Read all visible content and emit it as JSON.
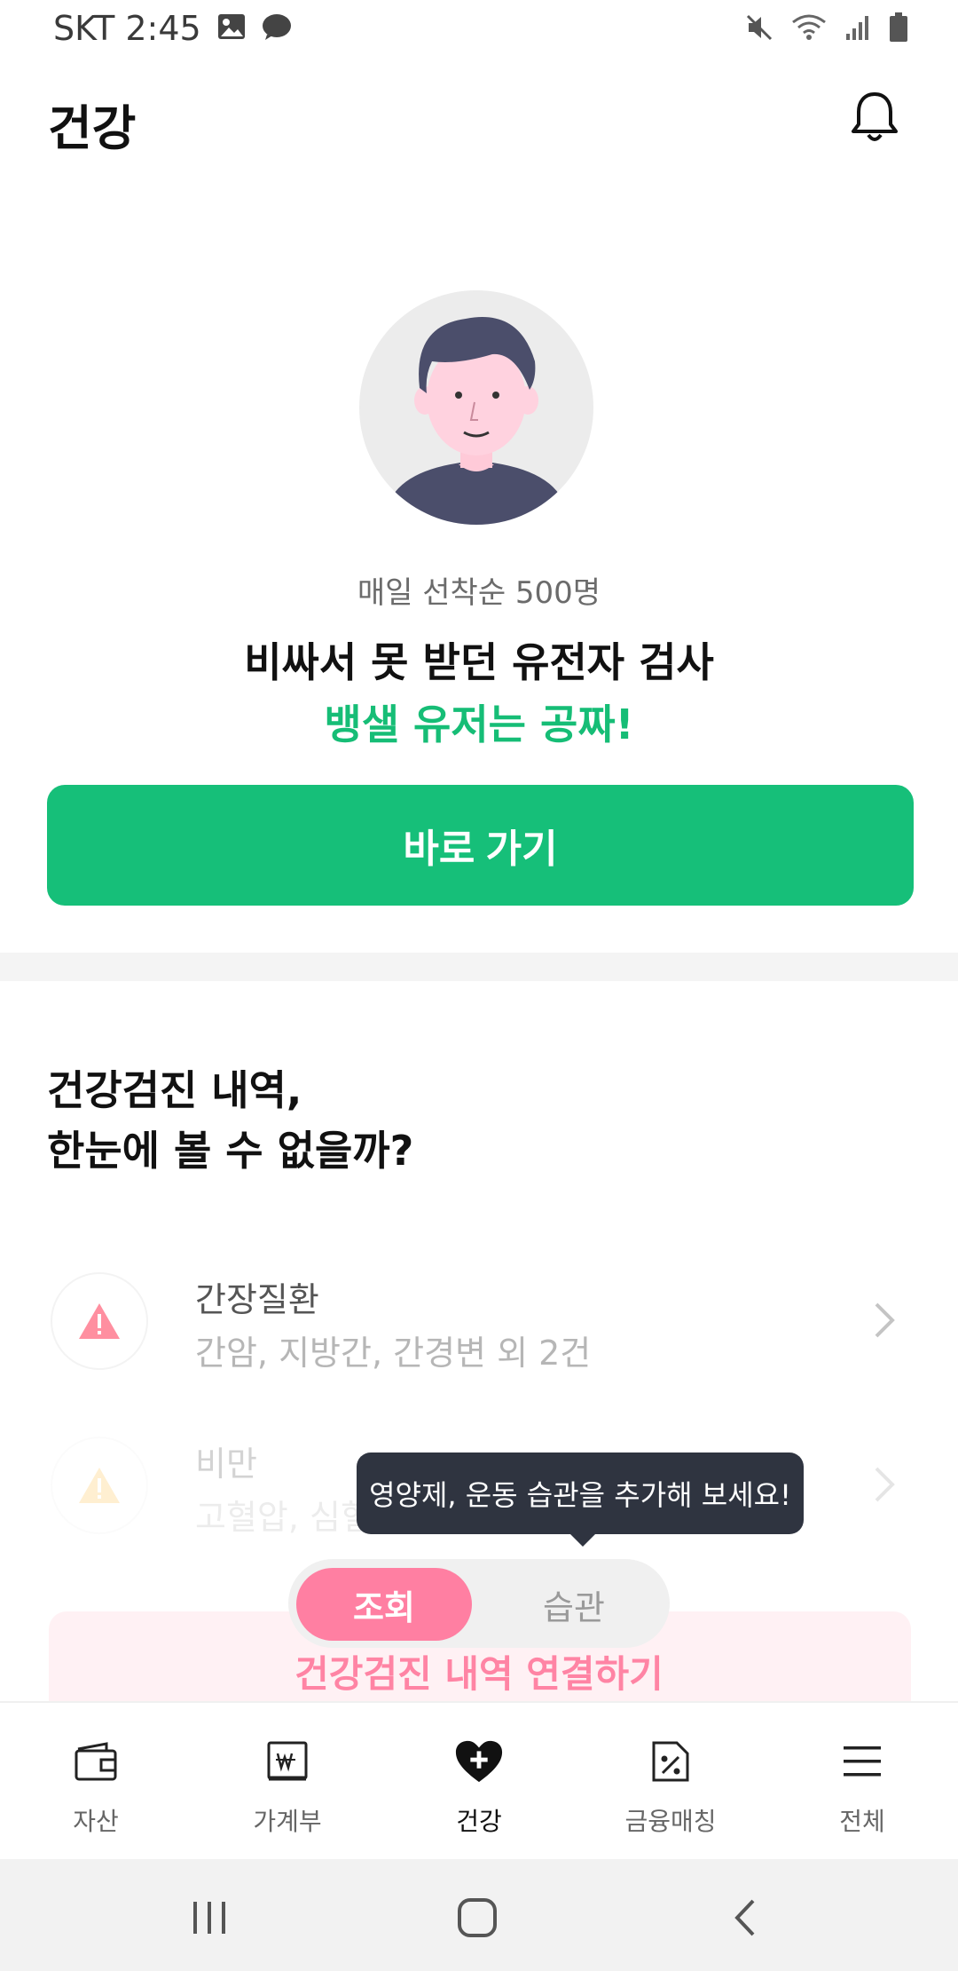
{
  "status_bar": {
    "carrier_time": "SKT 2:45",
    "icons": [
      "image-icon",
      "messenger-icon",
      "mute-icon",
      "wifi-icon",
      "signal-icon",
      "battery-icon"
    ]
  },
  "header": {
    "title": "건강",
    "bell_icon": "bell-icon"
  },
  "promo": {
    "subtitle": "매일 선착순 500명",
    "title": "비싸서 못 받던 유전자 검사",
    "highlight": "뱅샐 유저는 공짜!",
    "button_label": "바로 가기",
    "accent_color": "#16bf79"
  },
  "checkup_section": {
    "title_line1": "건강검진 내역,",
    "title_line2": "한눈에 볼 수 없을까?",
    "items": [
      {
        "name": "간장질환",
        "desc": "간암, 지방간, 간경변 외 2건",
        "icon": "warning-icon",
        "icon_color": "#ff8fa0"
      },
      {
        "name": "비만",
        "desc": "고혈압, 심혈",
        "icon": "warning-icon",
        "icon_color": "#ffc04a"
      }
    ],
    "connect_label": "건강검진 내역 연결하기"
  },
  "tooltip": {
    "text": "영양제, 운동 습관을 추가해 보세요!"
  },
  "segment": {
    "active_label": "조회",
    "inactive_label": "습관",
    "active_color": "#ff7fa2"
  },
  "bottom_nav": {
    "items": [
      {
        "label": "자산",
        "icon": "wallet-icon"
      },
      {
        "label": "가계부",
        "icon": "ledger-book-icon"
      },
      {
        "label": "건강",
        "icon": "heart-plus-icon",
        "active": true
      },
      {
        "label": "금융매칭",
        "icon": "coupon-percent-icon"
      },
      {
        "label": "전체",
        "icon": "menu-icon"
      }
    ]
  },
  "system_nav": {
    "icons": [
      "recent-apps-icon",
      "home-icon",
      "back-icon"
    ]
  }
}
